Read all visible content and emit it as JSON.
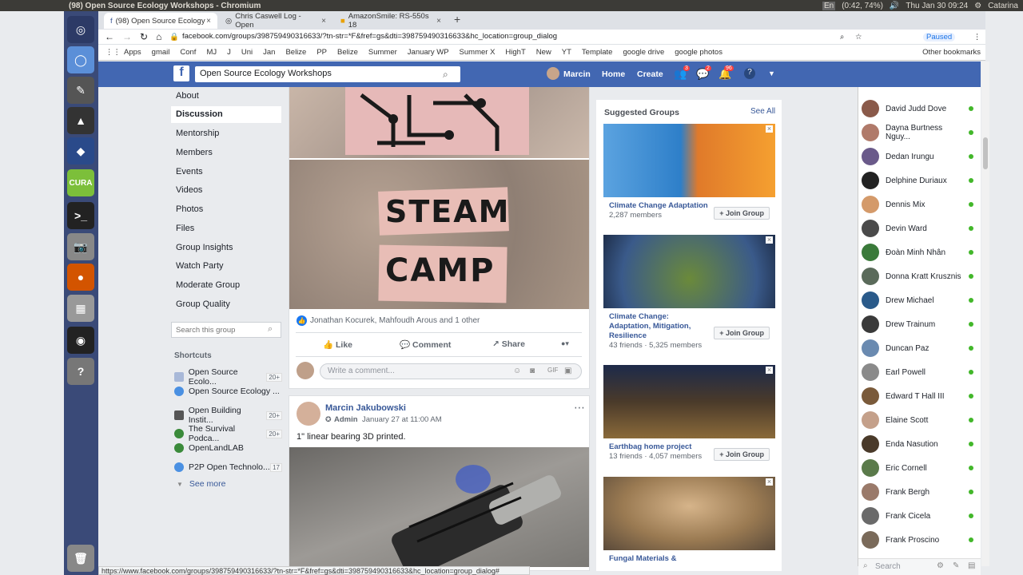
{
  "os": {
    "window_title": "(98) Open Source Ecology Workshops - Chromium",
    "battery": "(0:42, 74%)",
    "clock": "Thu Jan 30 09:24",
    "user": "Catarina",
    "lang": "En"
  },
  "tabs": [
    {
      "label": "(98) Open Source Ecology"
    },
    {
      "label": "Chris Caswell Log - Open"
    },
    {
      "label": "AmazonSmile: RS-550s 18"
    }
  ],
  "browser": {
    "url": "facebook.com/groups/398759490316633/?tn-str=*F&fref=gs&dti=398759490316633&hc_location=group_dialog",
    "paused": "Paused"
  },
  "bookmarks": [
    "Apps",
    "gmail",
    "Conf",
    "MJ",
    "J",
    "Uni",
    "Jan",
    "Belize",
    "PP",
    "Belize",
    "Summer",
    "January WP",
    "Summer X",
    "HighT",
    "New",
    "YT",
    "Template",
    "google drive",
    "google photos"
  ],
  "bookmarks_other": "Other bookmarks",
  "fb": {
    "search_value": "Open Source Ecology Workshops",
    "user": "Marcin",
    "home": "Home",
    "create": "Create",
    "badge_friends": "3",
    "badge_msgs": "2",
    "badge_notif": "96"
  },
  "leftnav": [
    "About",
    "Discussion",
    "Mentorship",
    "Members",
    "Events",
    "Videos",
    "Photos",
    "Files",
    "Group Insights",
    "Watch Party",
    "Moderate Group",
    "Group Quality"
  ],
  "group_search_placeholder": "Search this group",
  "shortcuts": {
    "title": "Shortcuts",
    "items": [
      {
        "label": "Open Source Ecolo...",
        "count": "20+"
      },
      {
        "label": "Open Source Ecology ...",
        "count": ""
      },
      {
        "label": "Open Building Instit...",
        "count": "20+"
      },
      {
        "label": "The Survival Podca...",
        "count": "20+"
      },
      {
        "label": "OpenLandLAB",
        "count": ""
      },
      {
        "label": "P2P Open Technolo...",
        "count": "17"
      }
    ],
    "see_more": "See more"
  },
  "post1": {
    "reactions": "Jonathan Kocurek, Mahfoudh Arous and 1 other",
    "like": "Like",
    "comment": "Comment",
    "share": "Share",
    "comment_placeholder": "Write a comment...",
    "image_text_1": "STEAM",
    "image_text_2": "CAMP"
  },
  "post2": {
    "author": "Marcin Jakubowski",
    "role": "Admin",
    "date": "January 27 at 11:00 AM",
    "text": "1\" linear bearing 3D printed."
  },
  "suggested": {
    "title": "Suggested Groups",
    "see_all": "See All",
    "join": "+ Join Group",
    "groups": [
      {
        "name": "Climate Change Adaptation",
        "sub": "2,287 members"
      },
      {
        "name": "Climate Change: Adaptation, Mitigation, Resilience",
        "sub": "43 friends · 5,325 members"
      },
      {
        "name": "Earthbag home project",
        "sub": "13 friends · 4,057 members"
      },
      {
        "name": "Fungal Materials &",
        "sub": ""
      }
    ]
  },
  "contacts": [
    "David Judd Dove",
    "Dayna Burtness Nguy...",
    "Dedan Irungu",
    "Delphine Duriaux",
    "Dennis Mix",
    "Devin Ward",
    "Đoàn Minh Nhân",
    "Donna Kratt Krusznis",
    "Drew Michael",
    "Drew Trainum",
    "Duncan Paz",
    "Earl Powell",
    "Edward T Hall III",
    "Elaine Scott",
    "Enda Nasution",
    "Eric Cornell",
    "Frank Bergh",
    "Frank Cicela",
    "Frank Proscino"
  ],
  "chat_search": "Search",
  "status_url": "https://www.facebook.com/groups/398759490316633/?tn-str=*F&fref=gs&dti=398759490316633&hc_location=group_dialog#"
}
